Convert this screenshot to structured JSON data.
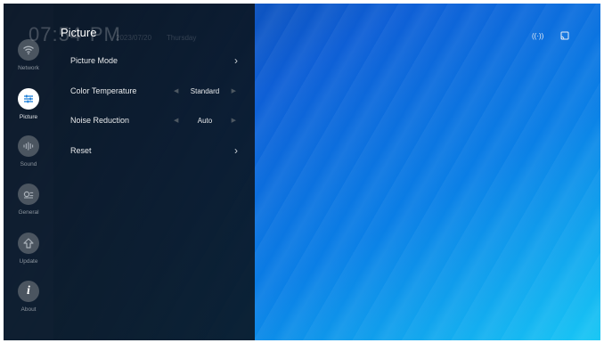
{
  "clock": {
    "time": "07:54",
    "ampm": "PM",
    "date": "2023/07/20",
    "day": "Thursday"
  },
  "panel": {
    "title": "Picture",
    "rows": [
      {
        "label": "Picture Mode",
        "type": "submenu"
      },
      {
        "label": "Color Temperature",
        "type": "select",
        "value": "Standard"
      },
      {
        "label": "Noise Reduction",
        "type": "select",
        "value": "Auto"
      },
      {
        "label": "Reset",
        "type": "submenu"
      }
    ]
  },
  "nav": [
    {
      "label": "Network",
      "icon": "wifi-icon"
    },
    {
      "label": "Picture",
      "icon": "sliders-icon",
      "active": true
    },
    {
      "label": "Sound",
      "icon": "sound-wave-icon"
    },
    {
      "label": "General",
      "icon": "general-settings-icon"
    },
    {
      "label": "Update",
      "icon": "upload-arrow-icon"
    },
    {
      "label": "About",
      "icon": "info-icon"
    }
  ],
  "status_icons": [
    "broadcast-icon",
    "cast-screen-icon"
  ],
  "colors": {
    "accent": "#1d7fd8",
    "rail_bg": "#0f1923",
    "background_blue": "#0e5fd6"
  }
}
